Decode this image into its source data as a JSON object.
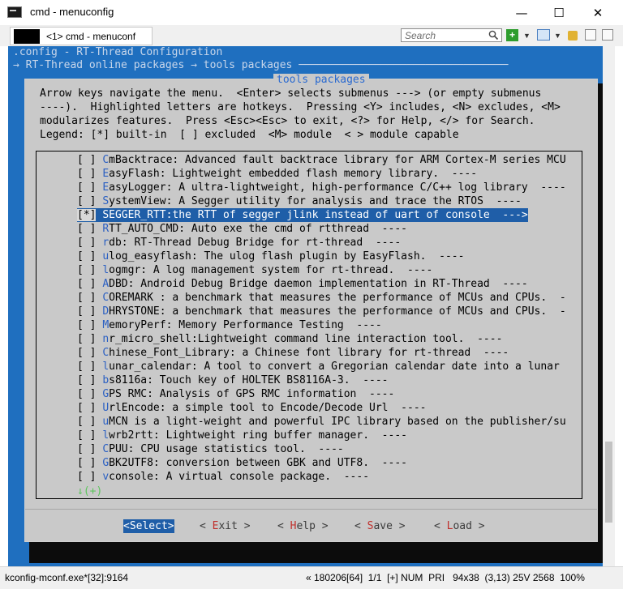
{
  "window": {
    "title": "cmd - menuconfig",
    "minimize": "—",
    "maximize": "☐",
    "close": "✕"
  },
  "toolbar": {
    "tab_label": "<1> cmd - menuconf",
    "search_placeholder": "Search",
    "icons": [
      "search-icon",
      "add-console-icon",
      "dropdown-icon",
      "layout-icon",
      "lock-icon",
      "panes-icon",
      "menu-icon"
    ]
  },
  "terminal": {
    "header_line1": ".config - RT-Thread Configuration",
    "header_line2": "→ RT-Thread online packages → tools packages ─────────────────────────────────",
    "dialog_title": "tools packages",
    "help_lines": [
      "Arrow keys navigate the menu.  <Enter> selects submenus ---> (or empty submenus",
      "----).  Highlighted letters are hotkeys.  Pressing <Y> includes, <N> excludes, <M>",
      "modularizes features.  Press <Esc><Esc> to exit, <?> for Help, </> for Search.",
      "Legend: [*] built-in  [ ] excluded  <M> module  < > module capable"
    ],
    "items": [
      {
        "mark": "[ ]",
        "hotkey": "C",
        "rest": "mBacktrace: Advanced fault backtrace library for ARM Cortex-M series MCU"
      },
      {
        "mark": "[ ]",
        "hotkey": "E",
        "rest": "asyFlash: Lightweight embedded flash memory library.  ----"
      },
      {
        "mark": "[ ]",
        "hotkey": "E",
        "rest": "asyLogger: A ultra-lightweight, high-performance C/C++ log library  ----"
      },
      {
        "mark": "[ ]",
        "hotkey": "S",
        "rest": "ystemView: A Segger utility for analysis and trace the RTOS  ----"
      },
      {
        "mark": "[*]",
        "hotkey": "S",
        "rest": "EGGER_RTT:the RTT of segger jlink instead of uart of console  --->",
        "selected": true
      },
      {
        "mark": "[ ]",
        "hotkey": "R",
        "rest": "TT_AUTO_CMD: Auto exe the cmd of rtthread  ----"
      },
      {
        "mark": "[ ]",
        "hotkey": "r",
        "rest": "db: RT-Thread Debug Bridge for rt-thread  ----"
      },
      {
        "mark": "[ ]",
        "hotkey": "u",
        "rest": "log_easyflash: The ulog flash plugin by EasyFlash.  ----"
      },
      {
        "mark": "[ ]",
        "hotkey": "l",
        "rest": "ogmgr: A log management system for rt-thread.  ----"
      },
      {
        "mark": "[ ]",
        "hotkey": "A",
        "rest": "DBD: Android Debug Bridge daemon implementation in RT-Thread  ----"
      },
      {
        "mark": "[ ]",
        "hotkey": "C",
        "rest": "OREMARK : a benchmark that measures the performance of MCUs and CPUs.  -"
      },
      {
        "mark": "[ ]",
        "hotkey": "D",
        "rest": "HRYSTONE: a benchmark that measures the performance of MCUs and CPUs.  -"
      },
      {
        "mark": "[ ]",
        "hotkey": "M",
        "rest": "emoryPerf: Memory Performance Testing  ----"
      },
      {
        "mark": "[ ]",
        "hotkey": "n",
        "rest": "r_micro_shell:Lightweight command line interaction tool.  ----"
      },
      {
        "mark": "[ ]",
        "hotkey": "C",
        "rest": "hinese_Font_Library: a Chinese font library for rt-thread  ----"
      },
      {
        "mark": "[ ]",
        "hotkey": "l",
        "rest": "unar_calendar: A tool to convert a Gregorian calendar date into a lunar"
      },
      {
        "mark": "[ ]",
        "hotkey": "b",
        "rest": "s8116a: Touch key of HOLTEK BS8116A-3.  ----"
      },
      {
        "mark": "[ ]",
        "hotkey": "G",
        "rest": "PS RMC: Analysis of GPS RMC information  ----"
      },
      {
        "mark": "[ ]",
        "hotkey": "U",
        "rest": "rlEncode: a simple tool to Encode/Decode Url  ----"
      },
      {
        "mark": "[ ]",
        "hotkey": "u",
        "rest": "MCN is a light-weight and powerful IPC library based on the publisher/su"
      },
      {
        "mark": "[ ]",
        "hotkey": "l",
        "rest": "wrb2rtt: Lightweight ring buffer manager.  ----"
      },
      {
        "mark": "[ ]",
        "hotkey": "C",
        "rest": "PUU: CPU usage statistics tool.  ----"
      },
      {
        "mark": "[ ]",
        "hotkey": "G",
        "rest": "BK2UTF8: conversion between GBK and UTF8.  ----"
      },
      {
        "mark": "[ ]",
        "hotkey": "v",
        "rest": "console: A virtual console package.  ----"
      }
    ],
    "more_indicator": "↓(+)",
    "buttons": [
      {
        "pre": "<",
        "hk": "S",
        "post": "elect>",
        "selected": true
      },
      {
        "pre": "< ",
        "hk": "E",
        "post": "xit >"
      },
      {
        "pre": "< ",
        "hk": "H",
        "post": "elp >"
      },
      {
        "pre": "< ",
        "hk": "S",
        "post": "ave >"
      },
      {
        "pre": "< ",
        "hk": "L",
        "post": "oad >"
      }
    ]
  },
  "statusbar": {
    "process": "kconfig-mconf.exe*[32]:9164",
    "info": "« 180206[64]  1/1  [+] NUM  PRI   94x38  (3,13) 25V 2568  100%"
  },
  "colors": {
    "terminal_blue": "#1f6fbf",
    "dialog_gray": "#c9c9c9",
    "selection": "#1f5ea8",
    "hotkey": "#2a5fc2"
  }
}
